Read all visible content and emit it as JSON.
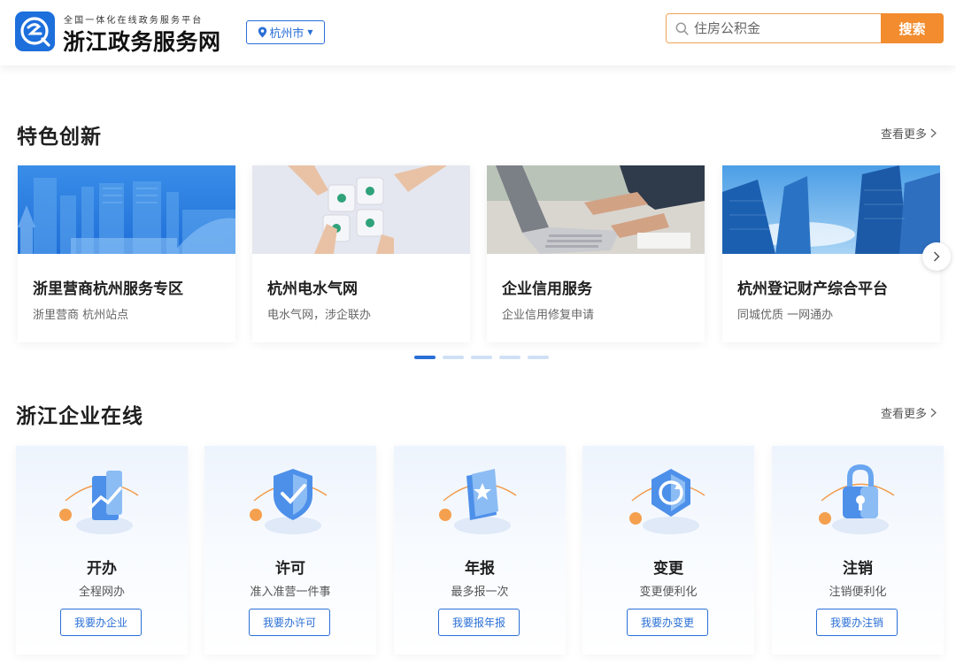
{
  "header": {
    "brand_subtitle": "全国一体化在线政务服务平台",
    "brand_name": "浙江政务服务网",
    "city": "杭州市",
    "search_placeholder": "住房公积金",
    "search_button": "搜索"
  },
  "featured": {
    "title": "特色创新",
    "more": "查看更多",
    "cards": [
      {
        "title": "浙里营商杭州服务专区",
        "desc": "浙里营商 杭州站点"
      },
      {
        "title": "杭州电水气网",
        "desc": "电水气网，涉企联办"
      },
      {
        "title": "企业信用服务",
        "desc": "企业信用修复申请"
      },
      {
        "title": "杭州登记财产综合平台",
        "desc": "同城优质 一网通办"
      }
    ],
    "pagination": {
      "total": 5,
      "active": 1
    }
  },
  "enterprise": {
    "title": "浙江企业在线",
    "more": "查看更多",
    "services": [
      {
        "name": "开办",
        "sub": "全程网办",
        "button": "我要办企业",
        "icon": "chart-cube-icon"
      },
      {
        "name": "许可",
        "sub": "准入准营一件事",
        "button": "我要办许可",
        "icon": "shield-check-icon"
      },
      {
        "name": "年报",
        "sub": "最多报一次",
        "button": "我要报年报",
        "icon": "report-book-icon"
      },
      {
        "name": "变更",
        "sub": "变更便利化",
        "button": "我要办变更",
        "icon": "refresh-hex-icon"
      },
      {
        "name": "注销",
        "sub": "注销便利化",
        "button": "我要办注销",
        "icon": "padlock-icon"
      }
    ]
  },
  "colors": {
    "primary": "#2a6fd6",
    "accent": "#f28c2e",
    "logo": "#1d6fdc"
  }
}
